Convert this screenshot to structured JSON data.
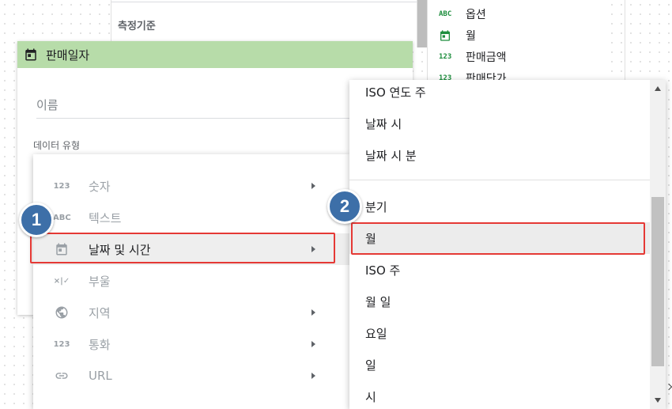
{
  "background": {
    "left_panel_title": "측정기준",
    "right_fields": [
      {
        "icon": "ABC",
        "label": "옵션"
      },
      {
        "icon": "calendar",
        "label": "월"
      },
      {
        "icon": "123",
        "label": "판매금액"
      },
      {
        "icon": "123",
        "label": "판매단가"
      }
    ]
  },
  "card": {
    "title": "판매일자",
    "name_placeholder": "이름",
    "data_type_label": "데이터 유형"
  },
  "type_menu": {
    "items": [
      {
        "icon": "123",
        "label": "숫자",
        "has_submenu": true
      },
      {
        "icon": "ABC",
        "label": "텍스트",
        "has_submenu": false
      },
      {
        "icon": "calendar",
        "label": "날짜 및 시간",
        "has_submenu": true
      },
      {
        "icon": "×|✓",
        "label": "부울",
        "has_submenu": false
      },
      {
        "icon": "globe",
        "label": "지역",
        "has_submenu": true
      },
      {
        "icon": "123",
        "label": "통화",
        "has_submenu": true
      },
      {
        "icon": "link",
        "label": "URL",
        "has_submenu": true
      }
    ]
  },
  "sub_menu": {
    "items": [
      "ISO 연도 주",
      "날짜 시",
      "날짜 시 분",
      "분기",
      "월",
      "ISO 주",
      "월 일",
      "요일",
      "일",
      "시"
    ],
    "selected": "월"
  },
  "annotations": {
    "badge_1": "1",
    "badge_2": "2",
    "highlight_color": "#e53935",
    "badge_color": "#3d6fa8"
  },
  "colors": {
    "header_green": "#b7dca9",
    "field_icon_green": "#1e8e3e"
  }
}
